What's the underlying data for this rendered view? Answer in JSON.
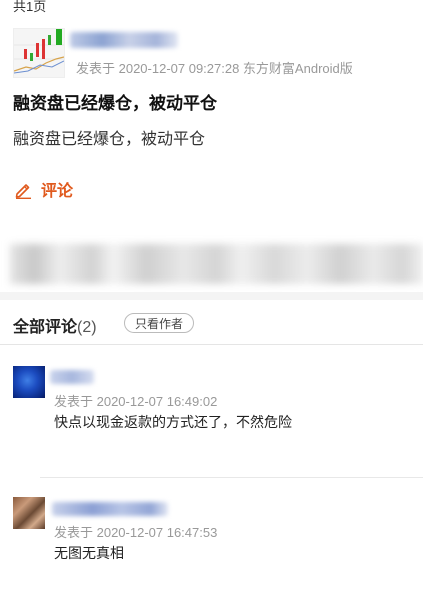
{
  "pager": {
    "text": "共1页"
  },
  "post": {
    "meta": "发表于 2020-12-07 09:27:28 东方财富Android版",
    "title": "融资盘已经爆仓，被动平仓",
    "body": "融资盘已经爆仓，被动平仓",
    "comment_label": "评论"
  },
  "comments_section": {
    "tab_label": "全部评论",
    "count": "(2)",
    "filter_button": "只看作者"
  },
  "comments": [
    {
      "meta": "发表于 2020-12-07 16:49:02",
      "text": "快点以现金返款的方式还了，不然危险"
    },
    {
      "meta": "发表于 2020-12-07 16:47:53",
      "text": "无图无真相"
    }
  ],
  "colors": {
    "accent": "#e05a1e",
    "meta": "#999999",
    "divider": "#f4f4f4"
  }
}
